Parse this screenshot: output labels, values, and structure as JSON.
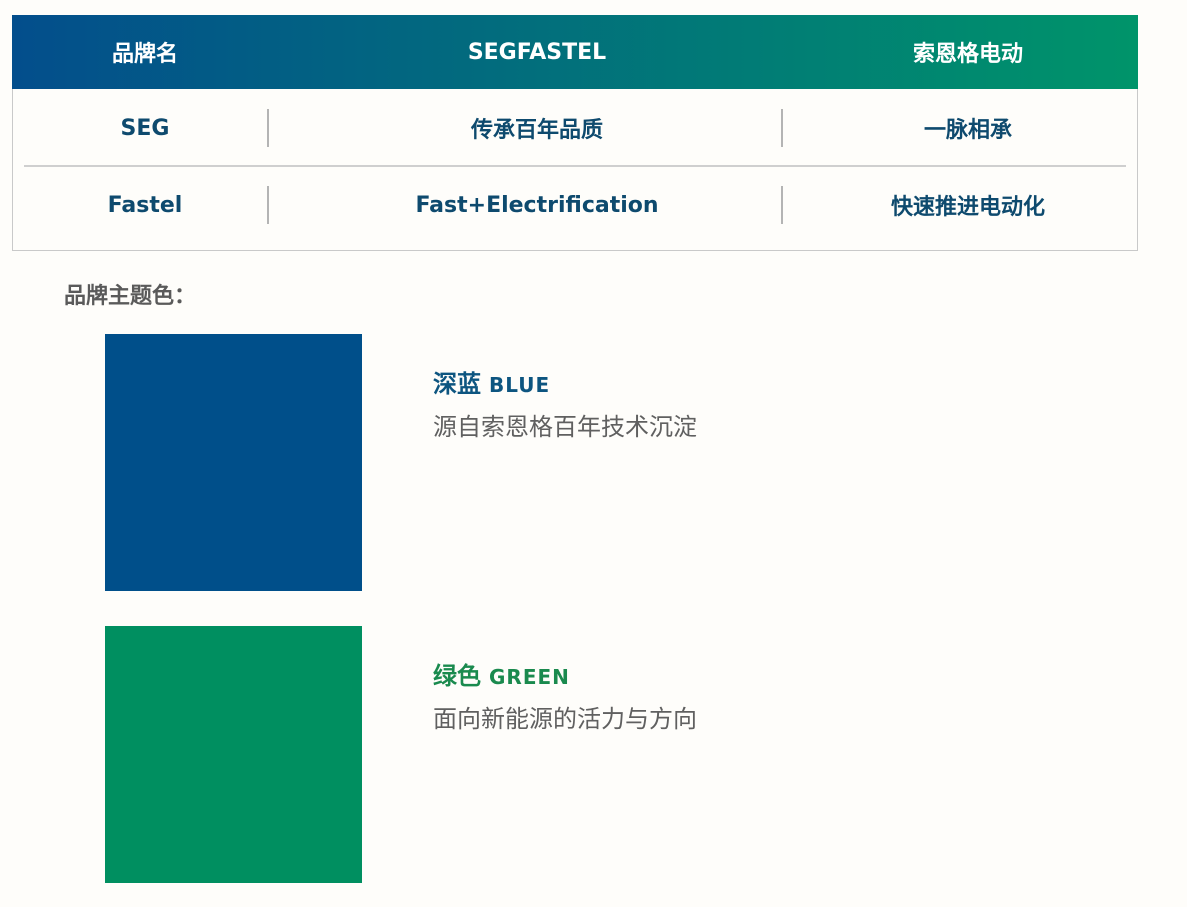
{
  "table": {
    "header": [
      "品牌名",
      "SEGFASTEL",
      "索恩格电动"
    ],
    "rows": [
      [
        "SEG",
        "传承百年品质",
        "一脉相承"
      ],
      [
        "Fastel",
        "Fast+Electrification",
        "快速推进电动化"
      ]
    ],
    "header_gradient": [
      "#034e8c",
      "#00946a"
    ]
  },
  "theme": {
    "heading": "品牌主题色：",
    "blue": {
      "name_cn": "深蓝",
      "name_en": "BLUE",
      "description": "源自索恩格百年技术沉淀",
      "color": "#004f8a"
    },
    "green": {
      "name_cn": "绿色",
      "name_en": "GREEN",
      "description": "面向新能源的活力与方向",
      "color": "#008f60"
    }
  }
}
